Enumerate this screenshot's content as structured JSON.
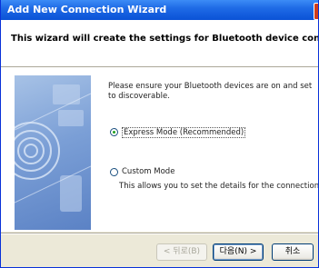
{
  "window": {
    "title": "Add New Connection Wizard"
  },
  "header": {
    "text": "This wizard will create the settings for Bluetooth device connection."
  },
  "main": {
    "description": "Please ensure your Bluetooth devices are on and set to discoverable.",
    "options": [
      {
        "label": "Express Mode (Recommended)",
        "selected": true
      },
      {
        "label": "Custom Mode",
        "selected": false
      }
    ],
    "custom_description": "This allows you to set the details for the connection."
  },
  "buttons": {
    "back": "< 뒤로(B)",
    "next": "다음(N) >",
    "cancel": "취소"
  },
  "colors": {
    "titlebar": "#0a52d6",
    "radio_dot": "#21a121"
  }
}
